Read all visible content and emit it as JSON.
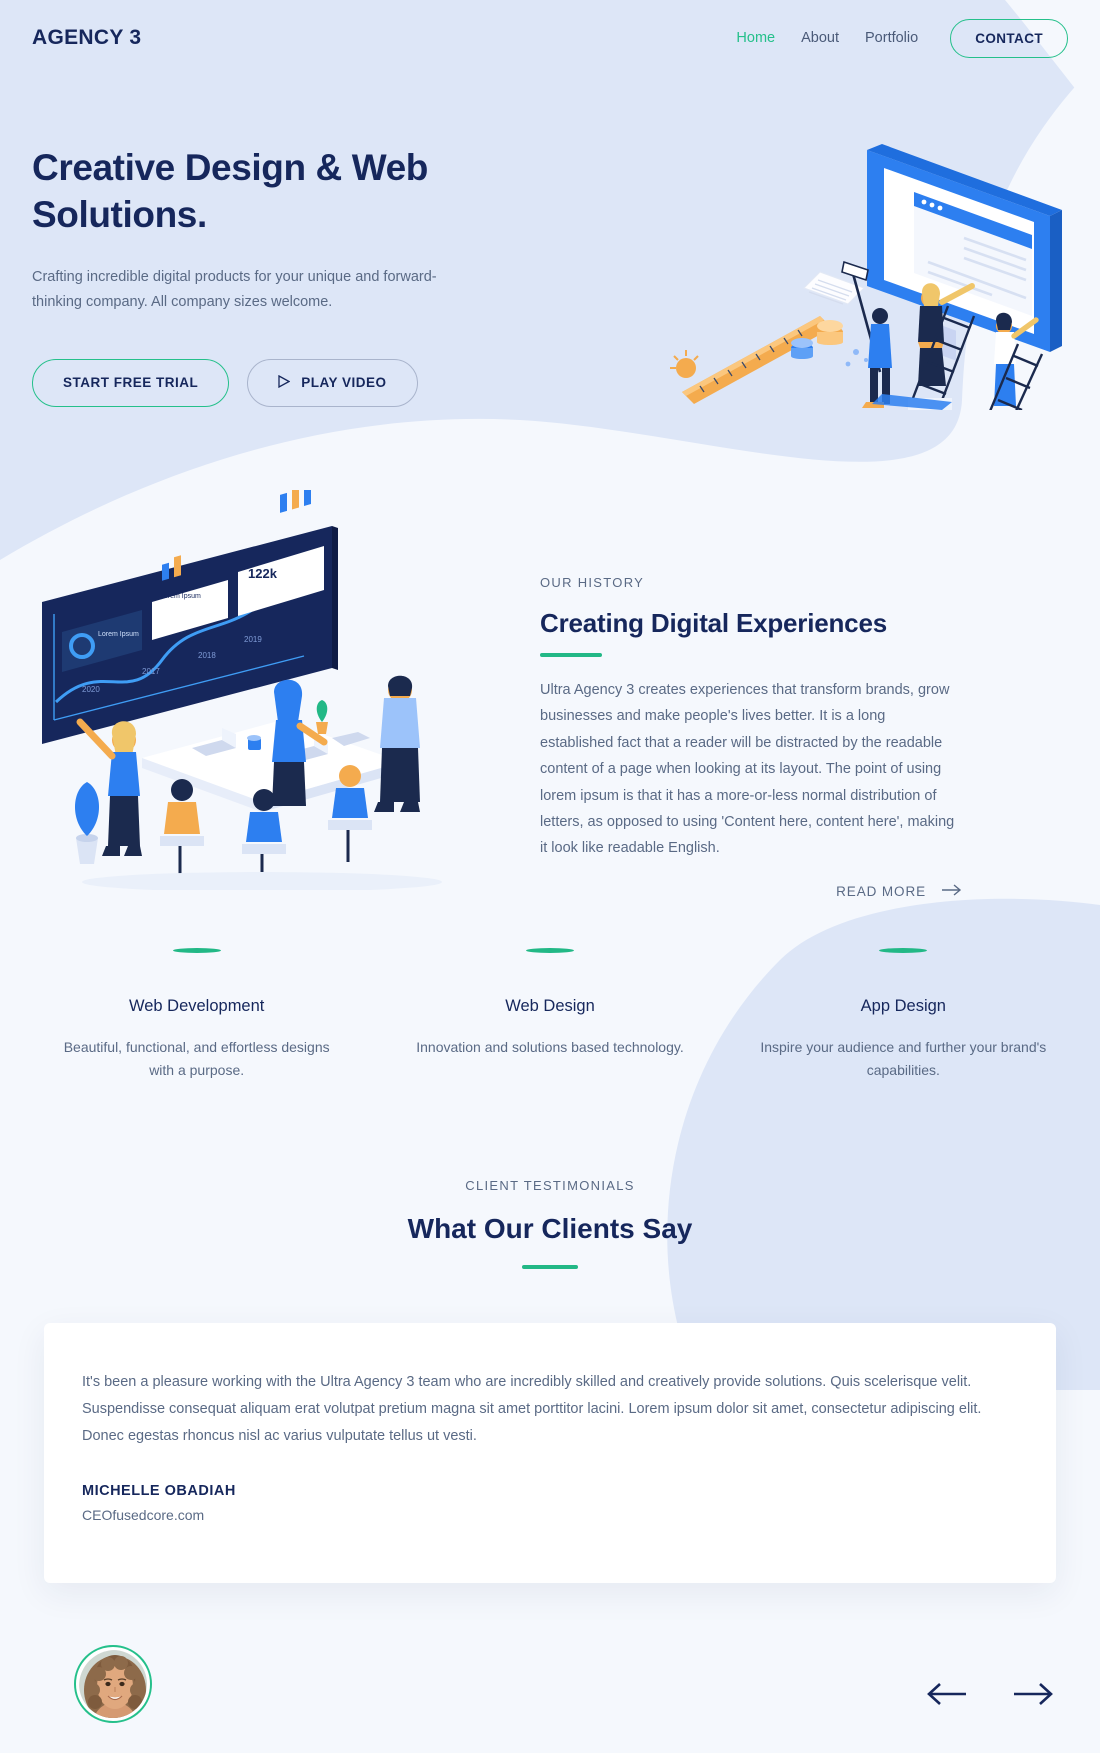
{
  "colors": {
    "brand_navy": "#16275c",
    "accent_teal": "#25c08b",
    "accent_teal_dark": "#22b886",
    "body_text": "#5a6a85",
    "hero_bg": "#dde6f7",
    "page_bg": "#f5f8fd",
    "card_bg": "#ffffff",
    "illustration_blue": "#2d7ff0"
  },
  "header": {
    "brand": "AGENCY 3",
    "nav": [
      {
        "label": "Home",
        "active": true
      },
      {
        "label": "About",
        "active": false
      },
      {
        "label": "Portfolio",
        "active": false
      }
    ],
    "contact_label": "CONTACT"
  },
  "hero": {
    "title": "Creative Design & Web Solutions.",
    "subtitle": "Crafting incredible digital products for your unique and forward-thinking company. All company sizes welcome.",
    "primary_button": "START FREE TRIAL",
    "secondary_button": "PLAY VIDEO",
    "secondary_icon": "play-triangle-icon",
    "illustration": "isometric-website-building-team-illustration"
  },
  "history": {
    "illustration": "isometric-team-meeting-dashboard-illustration",
    "illustration_labels": {
      "metric": "122k",
      "years": [
        "2017",
        "2018",
        "2019",
        "2020"
      ],
      "card_titles": [
        "Lorem Ipsum",
        "Lorem Ipsum",
        "Lorem Ipsum"
      ]
    },
    "eyebrow": "OUR HISTORY",
    "title": "Creating Digital Experiences",
    "body": "Ultra Agency 3 creates experiences that transform brands, grow businesses and make people's lives better. It is a long established fact that a reader will be distracted by the readable content of a page when looking at its layout. The point of using lorem ipsum is that it has a more-or-less normal distribution of letters, as opposed to using 'Content here, content here', making it look like readable English.",
    "read_more_label": "READ MORE",
    "read_more_icon": "arrow-right-icon"
  },
  "services": [
    {
      "name": "Web Development",
      "description": "Beautiful, functional, and effortless designs with a purpose."
    },
    {
      "name": "Web Design",
      "description": "Innovation and solutions based technology."
    },
    {
      "name": "App Design",
      "description": "Inspire your audience and further your brand's capabilities."
    }
  ],
  "testimonials": {
    "eyebrow": "CLIENT TESTIMONIALS",
    "title": "What Our Clients Say",
    "quote": "It's been a pleasure working with the Ultra Agency 3 team who are incredibly skilled and creatively provide solutions. Quis scelerisque velit. Suspendisse consequat aliquam erat volutpat pretium magna sit amet porttitor lacini. Lorem ipsum dolor sit amet, consectetur adipiscing elit. Donec egestas rhoncus nisl ac varius vulputate tellus ut vesti.",
    "author_name": "MICHELLE OBADIAH",
    "author_role": "CEOfusedcore.com",
    "avatar": "smiling-woman-portrait-avatar",
    "prev_icon": "arrow-left-icon",
    "next_icon": "arrow-right-icon"
  }
}
